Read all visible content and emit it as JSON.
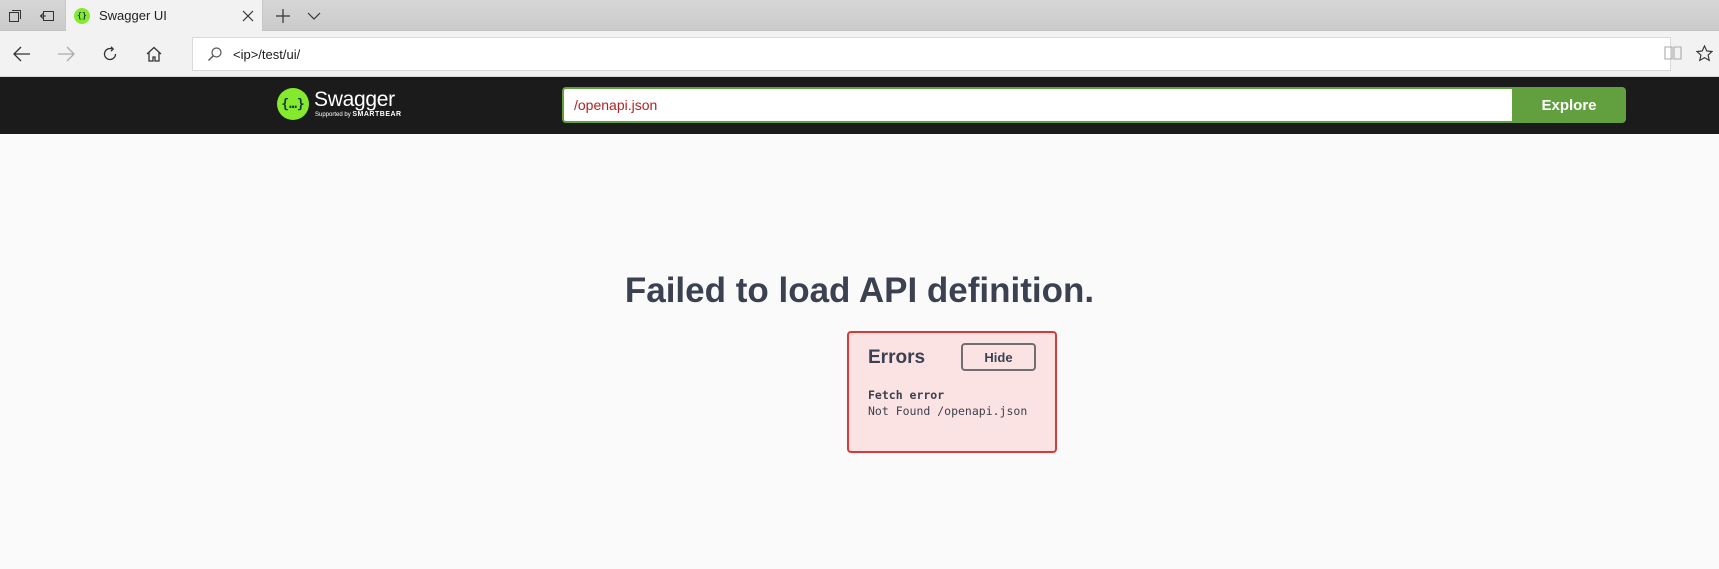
{
  "browser": {
    "tab": {
      "title": "Swagger UI"
    },
    "address_bar": {
      "url": "<ip>/test/ui/"
    }
  },
  "swagger": {
    "logo": {
      "name": "Swagger",
      "supported_by": "Supported by",
      "brand": "SMARTBEAR",
      "mark": "{…}"
    },
    "spec_url": "/openapi.json",
    "explore_label": "Explore",
    "colors": {
      "topbar": "#1b1b1b",
      "accent": "#62a03f",
      "logo_green": "#85ea2d",
      "error_border": "#d63a3a"
    }
  },
  "error_page": {
    "title": "Failed to load API definition.",
    "errors_heading": "Errors",
    "hide_label": "Hide",
    "error_type": "Fetch error",
    "error_message": "Not Found /openapi.json"
  }
}
